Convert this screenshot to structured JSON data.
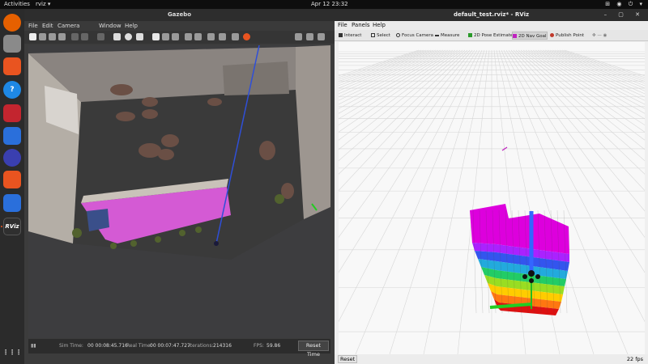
{
  "topbar": {
    "activities": "Activities",
    "app_name": "rviz ▾",
    "clock": "Apr 12  23:32",
    "system_icons": "⊞ ◉ ⏻ ▾"
  },
  "dock": {
    "items": [
      {
        "name": "firefox",
        "color": "#e66000",
        "glyph": ""
      },
      {
        "name": "files",
        "color": "#8a8a8a",
        "glyph": ""
      },
      {
        "name": "software",
        "color": "#e95420",
        "glyph": ""
      },
      {
        "name": "help",
        "color": "#1e88e5",
        "glyph": "?"
      },
      {
        "name": "terminal",
        "color": "#c3252f",
        "glyph": ""
      },
      {
        "name": "editor",
        "color": "#2a6fdb",
        "glyph": ""
      },
      {
        "name": "update",
        "color": "#3a3fb0",
        "glyph": ""
      },
      {
        "name": "layers",
        "color": "#e95420",
        "glyph": ""
      },
      {
        "name": "editor2",
        "color": "#2a6fdb",
        "glyph": ""
      },
      {
        "name": "rviz",
        "color": "#2f2f2f",
        "glyph": "RViz"
      }
    ],
    "apps_grid": "⋮⋮⋮"
  },
  "gazebo": {
    "title": "Gazebo",
    "menu": [
      "File",
      "Edit",
      "Camera",
      "Window",
      "Help"
    ],
    "status": {
      "steps_label": "▮▮",
      "sim_label": "Sim Time:",
      "sim_value": "00 00:08:45.716",
      "real_label": "Real Time:",
      "real_value": "00 00:07:47.727",
      "iter_label": "Iterations:",
      "iter_value": "214316",
      "fps_label": "FPS:",
      "fps_value": "59.86",
      "reset_label": "Reset Time"
    }
  },
  "rviz": {
    "title": "default_test.rviz* - RViz",
    "window_buttons": "– ▢ ✕",
    "menu": [
      "File",
      "Panels",
      "Help"
    ],
    "tools": [
      "Interact",
      "Select",
      "Focus Camera",
      "Measure",
      "2D Pose Estimate",
      "2D Nav Goal",
      "Publish Point"
    ],
    "tool_extra": "✥  —  ◉",
    "reset_label": "Reset",
    "fps": "22 fps"
  },
  "colors": {
    "accent": "#e95420",
    "rviz_bg": "#f8f8f8",
    "gazebo_bg": "#3d3d3f"
  }
}
